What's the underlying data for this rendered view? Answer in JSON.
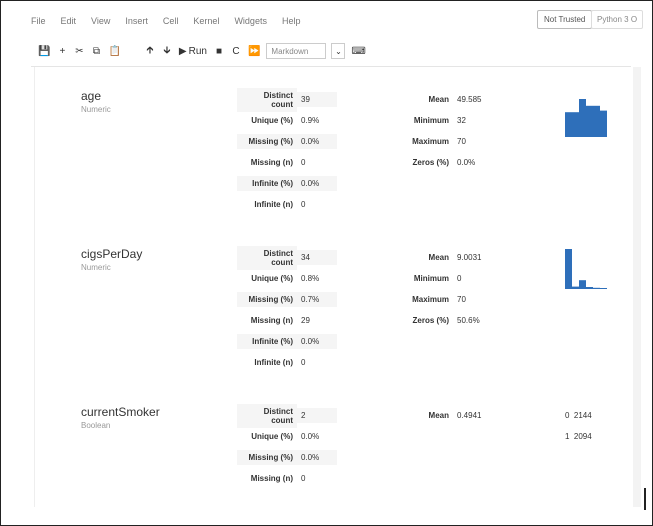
{
  "menu": [
    "File",
    "Edit",
    "View",
    "Insert",
    "Cell",
    "Kernel",
    "Widgets",
    "Help"
  ],
  "trusted_label": "Not Trusted",
  "kernel_label": "Python 3",
  "kernel_status": "O",
  "toolbar": {
    "run_label": "Run",
    "cell_type": "Markdown"
  },
  "variables": [
    {
      "name": "age",
      "type": "Numeric",
      "stats_left": [
        {
          "label": "Distinct count",
          "value": "39"
        },
        {
          "label": "Unique (%)",
          "value": "0.9%"
        },
        {
          "label": "Missing (%)",
          "value": "0.0%"
        },
        {
          "label": "Missing (n)",
          "value": "0"
        },
        {
          "label": "Infinite (%)",
          "value": "0.0%"
        },
        {
          "label": "Infinite (n)",
          "value": "0"
        }
      ],
      "stats_right": [
        {
          "label": "Mean",
          "value": "49.585"
        },
        {
          "label": "Minimum",
          "value": "32"
        },
        {
          "label": "Maximum",
          "value": "70"
        },
        {
          "label": "Zeros (%)",
          "value": "0.0%"
        }
      ]
    },
    {
      "name": "cigsPerDay",
      "type": "Numeric",
      "stats_left": [
        {
          "label": "Distinct count",
          "value": "34"
        },
        {
          "label": "Unique (%)",
          "value": "0.8%"
        },
        {
          "label": "Missing (%)",
          "value": "0.7%"
        },
        {
          "label": "Missing (n)",
          "value": "29"
        },
        {
          "label": "Infinite (%)",
          "value": "0.0%"
        },
        {
          "label": "Infinite (n)",
          "value": "0"
        }
      ],
      "stats_right": [
        {
          "label": "Mean",
          "value": "9.0031"
        },
        {
          "label": "Minimum",
          "value": "0"
        },
        {
          "label": "Maximum",
          "value": "70"
        },
        {
          "label": "Zeros (%)",
          "value": "50.6%"
        }
      ]
    },
    {
      "name": "currentSmoker",
      "type": "Boolean",
      "stats_left": [
        {
          "label": "Distinct count",
          "value": "2"
        },
        {
          "label": "Unique (%)",
          "value": "0.0%"
        },
        {
          "label": "Missing (%)",
          "value": "0.0%"
        },
        {
          "label": "Missing (n)",
          "value": "0"
        }
      ],
      "stats_right": [
        {
          "label": "Mean",
          "value": "0.4941"
        }
      ],
      "value_counts": [
        {
          "key": "0",
          "count": "2144"
        },
        {
          "key": "1",
          "count": "2094"
        }
      ]
    }
  ],
  "colors": {
    "hist": "#2e6fba"
  },
  "histograms": {
    "age": [
      0.62,
      0.62,
      0.95,
      0.78,
      0.78,
      0.66
    ],
    "cigsPerDay": [
      1.0,
      0.06,
      0.22,
      0.05,
      0.03,
      0.02
    ]
  }
}
